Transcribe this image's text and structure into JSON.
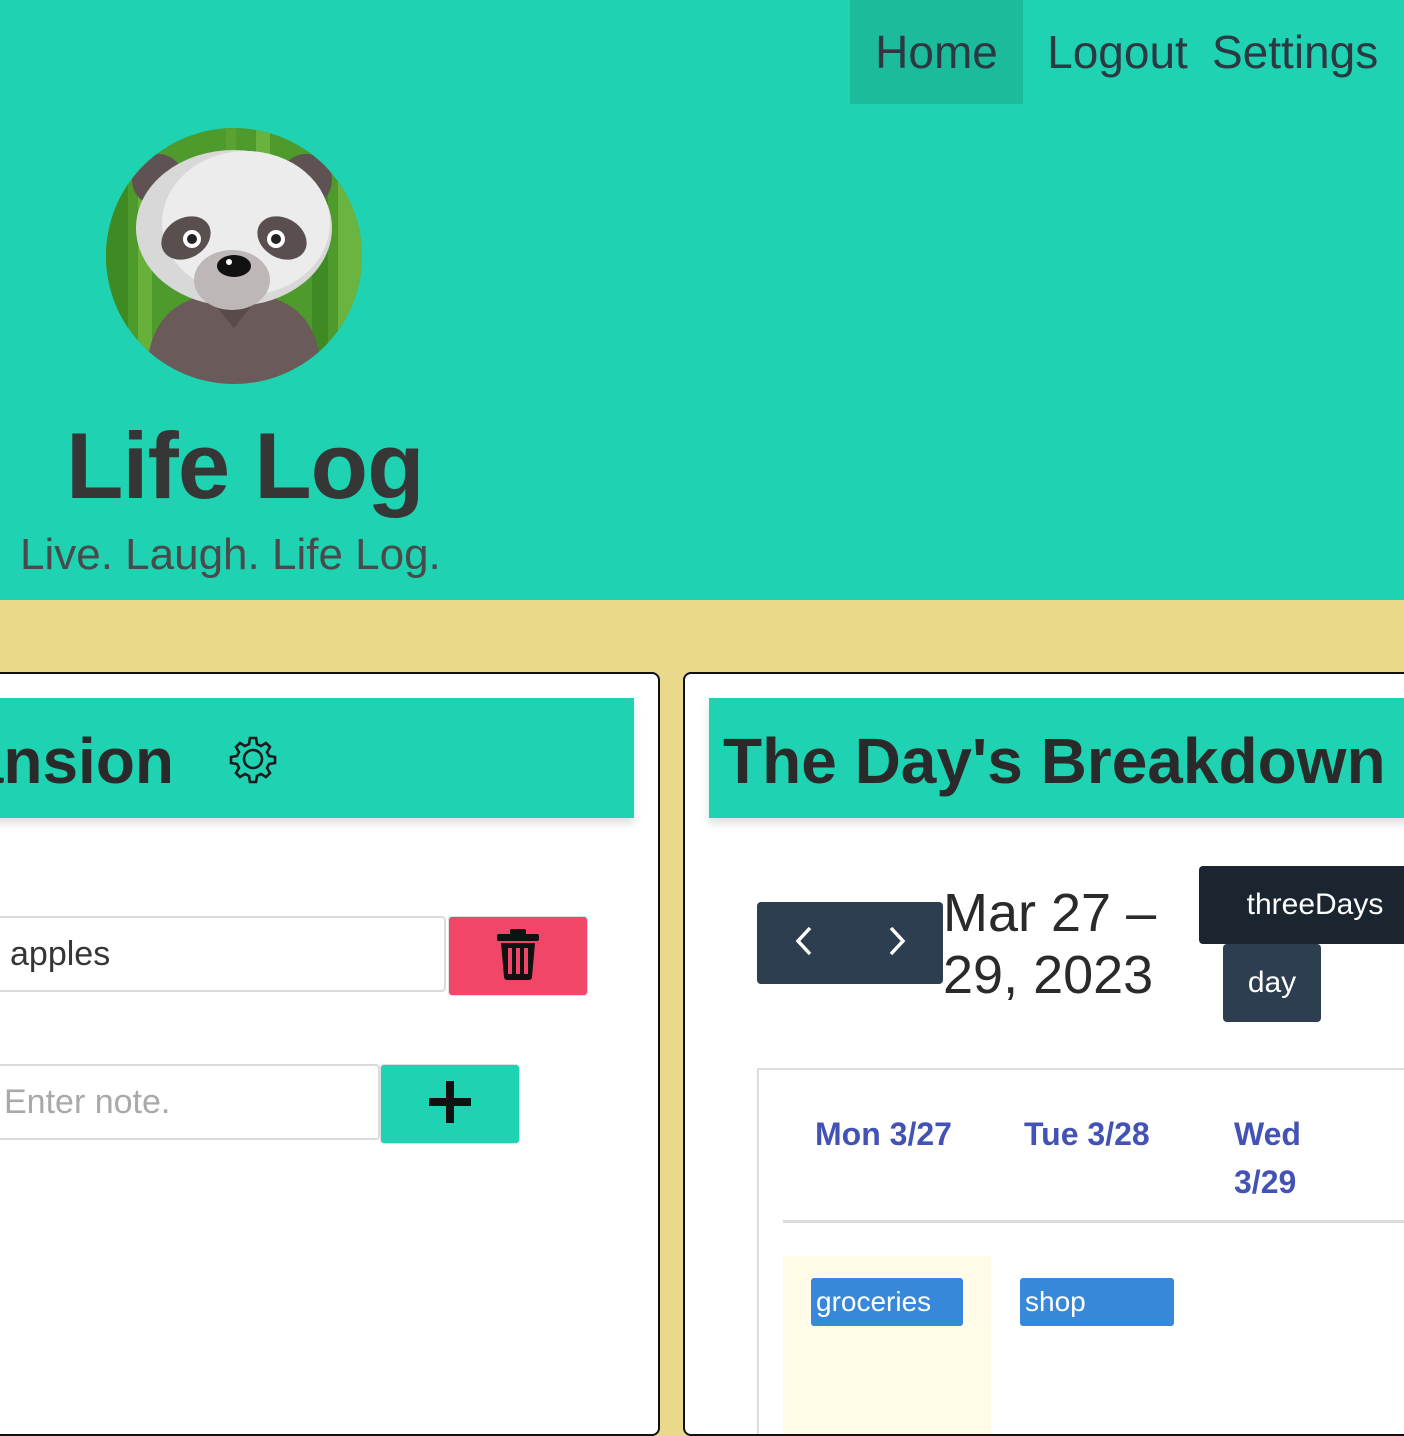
{
  "nav": {
    "items": [
      {
        "label": "Home"
      },
      {
        "label": "Logout"
      },
      {
        "label": "Settings"
      }
    ]
  },
  "hero": {
    "title": "Life Log",
    "subtitle": "Live. Laugh. Life Log.",
    "avatar": "panda-avatar"
  },
  "left_panel": {
    "title": "ansion",
    "gear_icon": "gear-icon",
    "item_value": "apples",
    "note_placeholder": "Enter note.",
    "delete_icon": "trash-icon",
    "add_icon": "plus-icon"
  },
  "right_panel": {
    "title": "The Day's Breakdown",
    "range_line1": "Mar 27 –",
    "range_line2": "29, 2023",
    "views": [
      "threeDays",
      "day"
    ],
    "days": [
      "Mon 3/27",
      "Tue 3/28",
      "Wed 3/29"
    ],
    "events": [
      {
        "title": "groceries"
      },
      {
        "title": "shop"
      }
    ]
  },
  "colors": {
    "hero": "#1ed2b2",
    "background": "#ead98b",
    "danger": "#f14668",
    "event": "#3788d8",
    "day_header": "#4353b5",
    "toolbar": "#2c3e50"
  }
}
